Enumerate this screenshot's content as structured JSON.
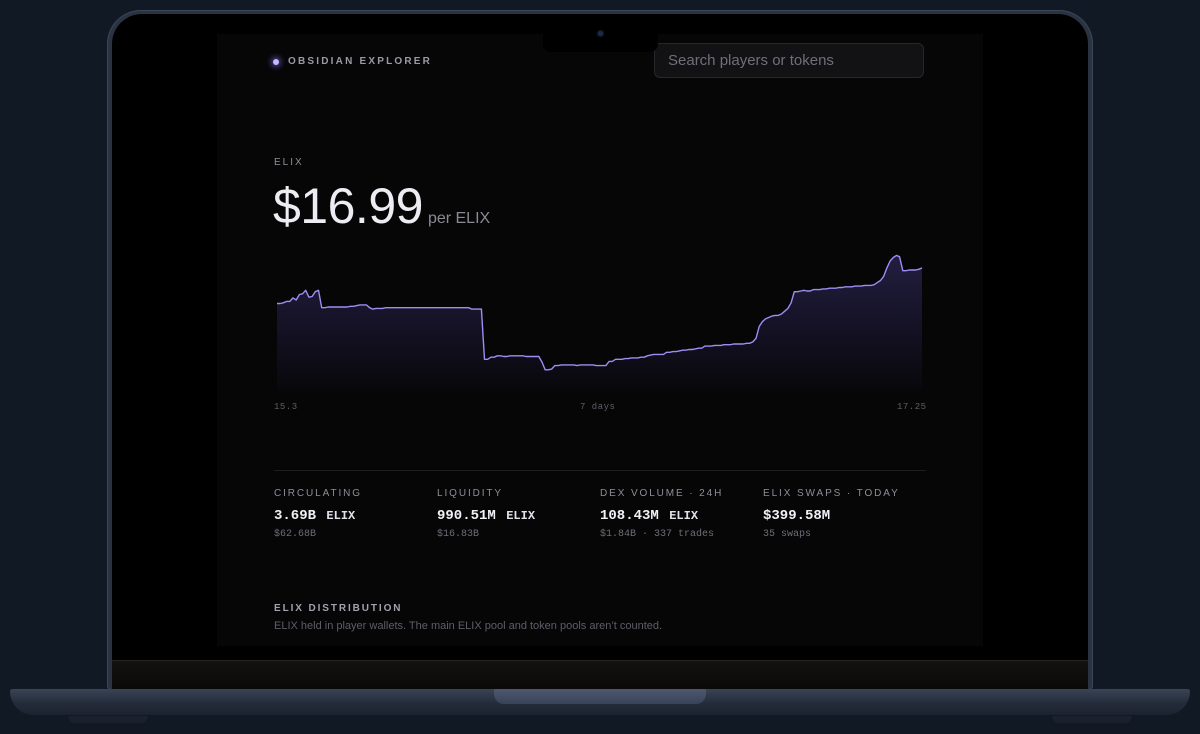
{
  "app": {
    "brand": "OBSIDIAN EXPLORER"
  },
  "search": {
    "placeholder": "Search players or tokens",
    "value": ""
  },
  "token": {
    "symbol": "ELIX",
    "price": "$16.99",
    "price_unit": "per ELIX"
  },
  "colors": {
    "accent": "#8f7ff0",
    "background": "#060607"
  },
  "chart_data": {
    "type": "area",
    "x_ticks": [
      "15.3",
      "7 days",
      "17.25"
    ],
    "ylim": [
      15.3,
      17.25
    ],
    "grid": false,
    "values": [
      16.54,
      16.54,
      16.55,
      16.57,
      16.57,
      16.62,
      16.59,
      16.67,
      16.68,
      16.73,
      16.63,
      16.64,
      16.71,
      16.73,
      16.48,
      16.48,
      16.49,
      16.49,
      16.49,
      16.49,
      16.49,
      16.49,
      16.49,
      16.5,
      16.5,
      16.51,
      16.52,
      16.52,
      16.52,
      16.48,
      16.46,
      16.47,
      16.47,
      16.47,
      16.48,
      16.48,
      16.48,
      16.48,
      16.48,
      16.48,
      16.48,
      16.48,
      16.48,
      16.48,
      16.48,
      16.48,
      16.48,
      16.48,
      16.48,
      16.48,
      16.48,
      16.48,
      16.48,
      16.48,
      16.48,
      16.48,
      16.48,
      16.48,
      16.48,
      16.48,
      16.48,
      16.46,
      16.46,
      16.46,
      16.46,
      15.74,
      15.74,
      15.77,
      15.77,
      15.79,
      15.79,
      15.78,
      15.78,
      15.79,
      15.79,
      15.79,
      15.79,
      15.79,
      15.78,
      15.78,
      15.78,
      15.78,
      15.78,
      15.7,
      15.59,
      15.59,
      15.6,
      15.65,
      15.65,
      15.66,
      15.66,
      15.66,
      15.66,
      15.66,
      15.65,
      15.66,
      15.66,
      15.66,
      15.66,
      15.66,
      15.65,
      15.65,
      15.65,
      15.65,
      15.71,
      15.71,
      15.74,
      15.74,
      15.74,
      15.75,
      15.75,
      15.76,
      15.76,
      15.76,
      15.77,
      15.77,
      15.79,
      15.8,
      15.81,
      15.81,
      15.81,
      15.81,
      15.84,
      15.84,
      15.85,
      15.85,
      15.86,
      15.87,
      15.87,
      15.88,
      15.88,
      15.89,
      15.9,
      15.9,
      15.93,
      15.93,
      15.93,
      15.94,
      15.94,
      15.94,
      15.95,
      15.95,
      15.95,
      15.96,
      15.96,
      15.96,
      15.96,
      15.97,
      15.97,
      15.99,
      16.04,
      16.21,
      16.28,
      16.32,
      16.34,
      16.36,
      16.37,
      16.37,
      16.39,
      16.43,
      16.47,
      16.55,
      16.71,
      16.71,
      16.72,
      16.73,
      16.72,
      16.72,
      16.74,
      16.74,
      16.74,
      16.75,
      16.75,
      16.76,
      16.76,
      16.76,
      16.77,
      16.77,
      16.78,
      16.78,
      16.78,
      16.79,
      16.79,
      16.79,
      16.8,
      16.8,
      16.8,
      16.81,
      16.84,
      16.87,
      16.93,
      17.05,
      17.15,
      17.2,
      17.23,
      17.21,
      17.01,
      17.01,
      17.02,
      17.02,
      17.02,
      17.03,
      17.05
    ]
  },
  "stats": [
    {
      "label": "CIRCULATING",
      "value": "3.69B",
      "unit": "ELIX",
      "sub": "$62.68B"
    },
    {
      "label": "LIQUIDITY",
      "value": "990.51M",
      "unit": "ELIX",
      "sub": "$16.83B"
    },
    {
      "label": "DEX VOLUME · 24H",
      "value": "108.43M",
      "unit": "ELIX",
      "sub": "$1.84B · 337 trades"
    },
    {
      "label": "ELIX SWAPS · TODAY",
      "value": "$399.58M",
      "unit": "",
      "sub": "35 swaps"
    }
  ],
  "distribution": {
    "title": "ELIX DISTRIBUTION",
    "description": "ELIX held in player wallets. The main ELIX pool and token pools aren’t counted."
  }
}
